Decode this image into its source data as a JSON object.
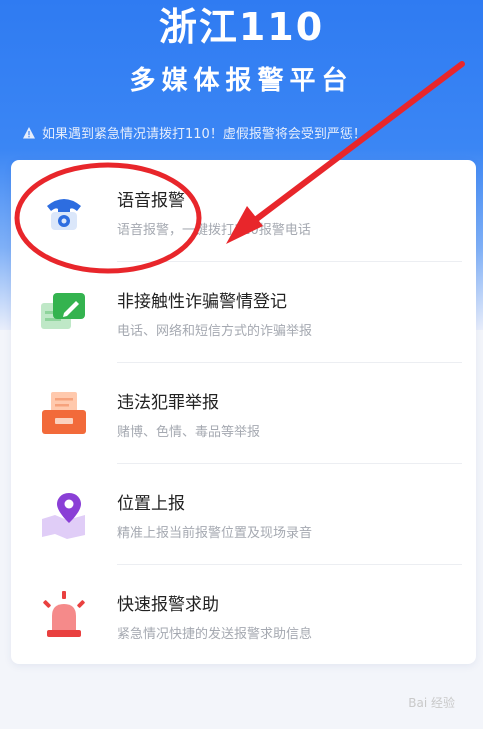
{
  "header": {
    "title": "浙江110",
    "subtitle": "多媒体报警平台",
    "warning": "如果遇到紧急情况请拨打110！虚假报警将会受到严惩！"
  },
  "services": [
    {
      "title": "语音报警",
      "desc": "语音报警，一键拨打110报警电话",
      "icon": "phone-icon"
    },
    {
      "title": "非接触性诈骗警情登记",
      "desc": "电话、网络和短信方式的诈骗举报",
      "icon": "message-edit-icon"
    },
    {
      "title": "违法犯罪举报",
      "desc": "赌博、色情、毒品等举报",
      "icon": "document-tray-icon"
    },
    {
      "title": "位置上报",
      "desc": "精准上报当前报警位置及现场录音",
      "icon": "location-map-icon"
    },
    {
      "title": "快速报警求助",
      "desc": "紧急情况快捷的发送报警求助信息",
      "icon": "siren-icon"
    }
  ],
  "colors": {
    "brand_blue": "#2f7bf2",
    "annotation_red": "#e8262b"
  },
  "watermark": "Bai 经验"
}
